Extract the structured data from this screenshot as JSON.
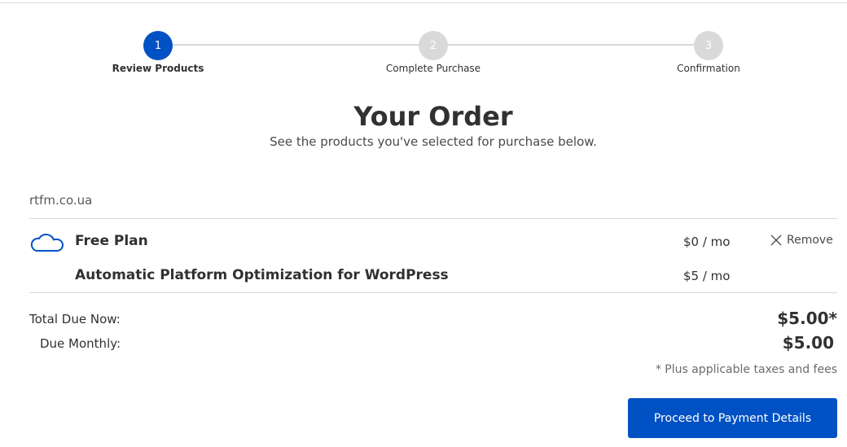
{
  "stepper": {
    "steps": [
      {
        "number": "1",
        "label": "Review Products",
        "state": "active"
      },
      {
        "number": "2",
        "label": "Complete Purchase",
        "state": "inactive"
      },
      {
        "number": "3",
        "label": "Confirmation",
        "state": "inactive"
      }
    ]
  },
  "header": {
    "title": "Your Order",
    "subtitle": "See the products you've selected for purchase below."
  },
  "domain": "rtfm.co.ua",
  "items": [
    {
      "icon": "cloud-icon",
      "name": "Free Plan",
      "price": "$0 / mo",
      "remove_label": "Remove"
    },
    {
      "name": "Automatic Platform Optimization for WordPress",
      "price": "$5 / mo"
    }
  ],
  "totals": {
    "due_now_label": "Total Due Now:",
    "due_now_amount": "$5.00*",
    "monthly_label": "Due Monthly:",
    "monthly_amount": "$5.00",
    "tax_note": "* Plus applicable taxes and fees"
  },
  "actions": {
    "proceed_label": "Proceed to Payment Details"
  },
  "colors": {
    "accent": "#0051c3",
    "inactive_step": "#d9d9d9"
  }
}
